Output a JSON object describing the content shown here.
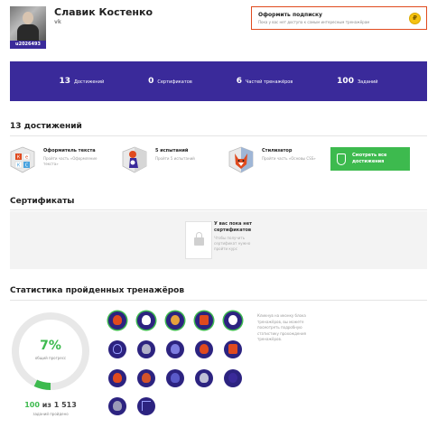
{
  "profile": {
    "name": "Славик Костенко",
    "social": "vk",
    "user_id": "u2026493"
  },
  "subscribe": {
    "title": "Оформить подписку",
    "description": "Пока у вас нет доступа к самым интересным тренажёрам",
    "icon": "coin-icon"
  },
  "stats": [
    {
      "num": "13",
      "label": "Достижений"
    },
    {
      "num": "0",
      "label": "Сертификатов"
    },
    {
      "num": "6",
      "label": "Частей тренажёров"
    },
    {
      "num": "100",
      "label": "Заданий"
    }
  ],
  "achievements": {
    "title": "13 достижений",
    "items": [
      {
        "title": "Оформитель текста",
        "desc": "Пройти часть «Оформление текста»",
        "icon": "kek-badge-icon"
      },
      {
        "title": "5 испытаний",
        "desc": "Пройти 5 испытаний",
        "icon": "cat-badge-icon"
      },
      {
        "title": "Стилизатор",
        "desc": "Пройти часть «Основы CSS»",
        "icon": "fox-badge-icon"
      }
    ],
    "all_button": [
      "Смотреть все",
      "достижения"
    ]
  },
  "certificates": {
    "title": "Сертификаты",
    "empty_title": [
      "У вас пока нет",
      "сертификатов"
    ],
    "empty_desc": [
      "Чтобы получить",
      "сертификат нужно",
      "пройти курс"
    ]
  },
  "trainers_stats": {
    "title": "Статистика пройденных тренажёров",
    "percent": "7%",
    "percent_value": 0.07,
    "percent_label": "общий прогресс",
    "done": "100",
    "of": "из",
    "total": "1 513",
    "count_label": "заданий пройдено",
    "hint": [
      "Кликнув на иконку блока",
      "тренажёров, вы можете",
      "посмотреть подробную",
      "статистику прохождения",
      "тренажёров."
    ]
  },
  "colors": {
    "accent": "#3a2a9a",
    "green": "#3dba4e",
    "orange": "#e04a1e"
  }
}
